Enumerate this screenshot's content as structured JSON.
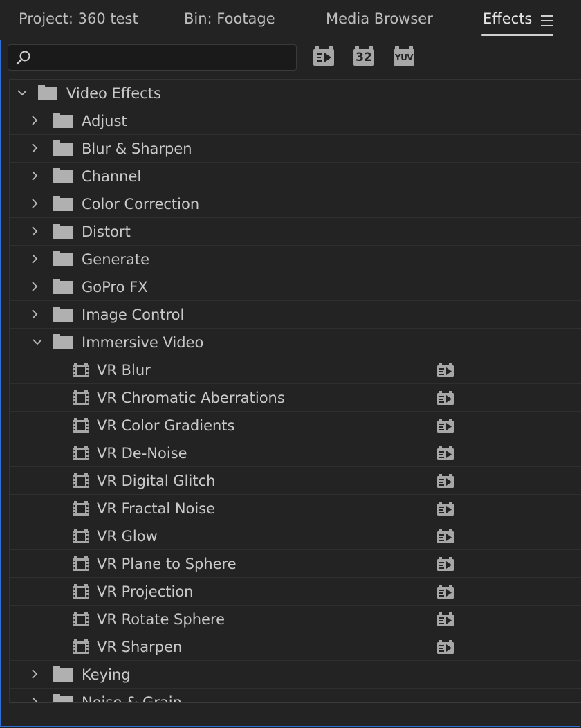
{
  "tabs": [
    {
      "label": "Project: 360 test",
      "active": false
    },
    {
      "label": "Bin: Footage",
      "active": false
    },
    {
      "label": "Media Browser",
      "active": false
    },
    {
      "label": "Effects",
      "active": true
    }
  ],
  "search": {
    "value": "",
    "placeholder": ""
  },
  "toolbar": {
    "accelerated_icon": "accelerated-effects-icon",
    "bit32_label": "32",
    "yuv_label": "YUV"
  },
  "tree": {
    "root": {
      "label": "Video Effects",
      "expanded": true
    },
    "folders_before": [
      "Adjust",
      "Blur & Sharpen",
      "Channel",
      "Color Correction",
      "Distort",
      "Generate",
      "GoPro FX",
      "Image Control"
    ],
    "open_folder": {
      "label": "Immersive Video",
      "expanded": true
    },
    "effects": [
      "VR Blur",
      "VR Chromatic Aberrations",
      "VR Color Gradients",
      "VR De-Noise",
      "VR Digital Glitch",
      "VR Fractal Noise",
      "VR Glow",
      "VR Plane to Sphere",
      "VR Projection",
      "VR Rotate Sphere",
      "VR Sharpen"
    ],
    "folders_after": [
      "Keying",
      "Noise & Grain"
    ]
  },
  "colors": {
    "accent": "#2d6fd6",
    "background": "#232323",
    "icon": "#a7a7a7"
  }
}
